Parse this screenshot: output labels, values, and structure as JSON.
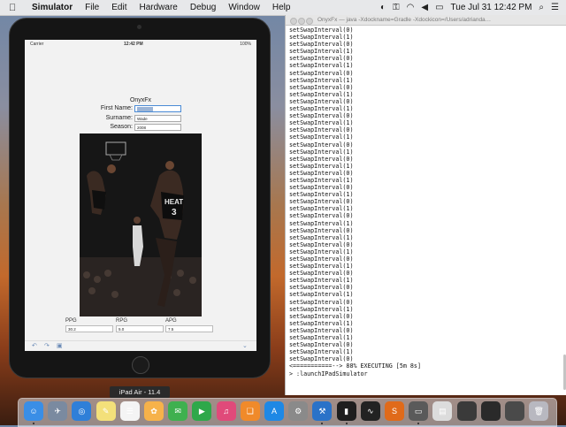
{
  "menubar": {
    "apple_icon": "apple-icon",
    "items": [
      "Simulator",
      "File",
      "Edit",
      "Hardware",
      "Debug",
      "Window",
      "Help"
    ],
    "clock": "Tue Jul 31  12:42 PM"
  },
  "simulator": {
    "device_label": "iPad Air - 11.4",
    "status": {
      "carrier": "Carrier",
      "time": "12:42 PM",
      "battery": "100%"
    },
    "app": {
      "title": "OnyxFx",
      "fields": [
        {
          "label": "First Name:",
          "value": ""
        },
        {
          "label": "Surname:",
          "value": "Wade"
        },
        {
          "label": "Season:",
          "value": "2008"
        }
      ],
      "stats": [
        {
          "label": "PPG",
          "value": "30.2"
        },
        {
          "label": "RPG",
          "value": "5.0"
        },
        {
          "label": "APG",
          "value": "7.5"
        }
      ],
      "toolbar": {
        "undo_icon": "undo-icon",
        "redo_icon": "redo-icon",
        "paste_icon": "clipboard-icon",
        "hide_icon": "chevron-down-icon"
      },
      "photo": {
        "jersey_name": "HEAT",
        "jersey_number": "3"
      }
    }
  },
  "terminal": {
    "title": "OnyxFx — java -Xdockname=Gradle -Xdockicon=/Users/adrianda…",
    "lines": [
      "setSwapInterval(0)",
      "setSwapInterval(1)",
      "setSwapInterval(0)",
      "setSwapInterval(1)",
      "setSwapInterval(0)",
      "setSwapInterval(1)",
      "setSwapInterval(0)",
      "setSwapInterval(1)",
      "setSwapInterval(0)",
      "setSwapInterval(1)",
      "setSwapInterval(0)",
      "setSwapInterval(1)",
      "setSwapInterval(0)",
      "setSwapInterval(1)",
      "setSwapInterval(0)",
      "setSwapInterval(1)",
      "setSwapInterval(0)",
      "setSwapInterval(1)",
      "setSwapInterval(0)",
      "setSwapInterval(1)",
      "setSwapInterval(0)",
      "setSwapInterval(1)",
      "setSwapInterval(0)",
      "setSwapInterval(1)",
      "setSwapInterval(0)",
      "setSwapInterval(1)",
      "setSwapInterval(0)",
      "setSwapInterval(1)",
      "setSwapInterval(0)",
      "setSwapInterval(1)",
      "setSwapInterval(0)",
      "setSwapInterval(1)",
      "setSwapInterval(0)",
      "setSwapInterval(1)",
      "setSwapInterval(0)",
      "setSwapInterval(1)",
      "setSwapInterval(0)",
      "setSwapInterval(1)",
      "setSwapInterval(0)",
      "setSwapInterval(1)",
      "setSwapInterval(0)",
      "setSwapInterval(1)",
      "setSwapInterval(0)",
      "setSwapInterval(1)",
      "setSwapInterval(0)",
      "setSwapInterval(1)",
      "setSwapInterval(0)",
      "<===========--> 88% EXECUTING [5m 8s]",
      "> :launchIPadSimulator"
    ],
    "traffic_light_color": "#d0d0d0"
  },
  "dock": {
    "icons": [
      {
        "name": "finder-icon",
        "color": "#3a8ee6",
        "glyph": "☺"
      },
      {
        "name": "launchpad-icon",
        "color": "#7a8aa0",
        "glyph": "✈"
      },
      {
        "name": "safari-icon",
        "color": "#2f7fd8",
        "glyph": "◎"
      },
      {
        "name": "notes-icon",
        "color": "#f3e07a",
        "glyph": "✎"
      },
      {
        "name": "reminders-icon",
        "color": "#f4f4f4",
        "glyph": "☰"
      },
      {
        "name": "photos-icon",
        "color": "#f6b24a",
        "glyph": "✿"
      },
      {
        "name": "messages-icon",
        "color": "#3fb04f",
        "glyph": "✉"
      },
      {
        "name": "facetime-icon",
        "color": "#2ea84a",
        "glyph": "▶"
      },
      {
        "name": "itunes-icon",
        "color": "#e04a7a",
        "glyph": "♫"
      },
      {
        "name": "ibooks-icon",
        "color": "#f08a2a",
        "glyph": "❑"
      },
      {
        "name": "app-store-icon",
        "color": "#1e88e5",
        "glyph": "A"
      },
      {
        "name": "system-preferences-icon",
        "color": "#8a8a8a",
        "glyph": "⚙"
      },
      {
        "name": "xcode-icon",
        "color": "#2a72c8",
        "glyph": "⚒"
      },
      {
        "name": "terminal-icon",
        "color": "#1e1e1e",
        "glyph": "▮"
      },
      {
        "name": "activity-monitor-icon",
        "color": "#222222",
        "glyph": "∿"
      },
      {
        "name": "sublime-text-icon",
        "color": "#e06a1a",
        "glyph": "S"
      },
      {
        "name": "simulator-icon",
        "color": "#5a5a5a",
        "glyph": "▭"
      },
      {
        "name": "preview-icon",
        "color": "#dcdcdc",
        "glyph": "▤"
      },
      {
        "name": "window-thumbnail-1",
        "color": "#3a3a3a",
        "glyph": ""
      },
      {
        "name": "window-thumbnail-2",
        "color": "#2a2a2a",
        "glyph": ""
      },
      {
        "name": "window-thumbnail-3",
        "color": "#4a4a4a",
        "glyph": ""
      },
      {
        "name": "trash-icon",
        "color": "#b8b8c0",
        "glyph": "🗑"
      }
    ]
  }
}
